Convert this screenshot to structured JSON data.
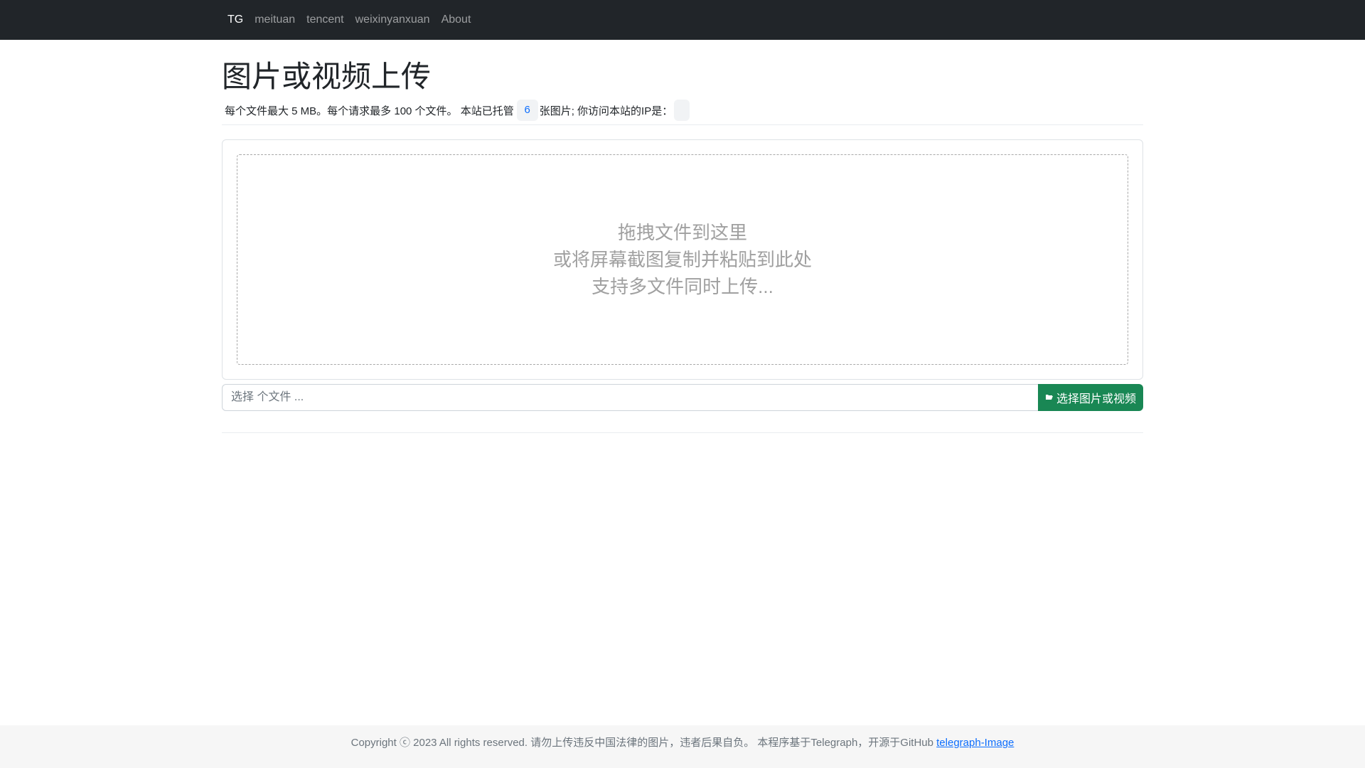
{
  "nav": {
    "items": [
      {
        "label": "TG",
        "active": true
      },
      {
        "label": "meituan",
        "active": false
      },
      {
        "label": "tencent",
        "active": false
      },
      {
        "label": "weixinyanxuan",
        "active": false
      },
      {
        "label": "About",
        "active": false
      }
    ]
  },
  "header": {
    "title": "图片或视频上传",
    "info_prefix": "每个文件最大 5 MB。每个请求最多 100 个文件。 本站已托管",
    "hosted_count": "6",
    "info_suffix": "张图片; 你访问本站的IP是：",
    "ip_value": ""
  },
  "dropzone": {
    "line1": "拖拽文件到这里",
    "line2": "或将屏幕截图复制并粘贴到此处",
    "line3": "支持多文件同时上传..."
  },
  "file_picker": {
    "placeholder": "选择 个文件 ...",
    "button_label": "选择图片或视频",
    "button_icon": "folder-open-icon"
  },
  "footer": {
    "text": "Copyright ⓒ 2023 All rights reserved. 请勿上传违反中国法律的图片，违者后果自负。 本程序基于Telegraph，开源于GitHub ",
    "link_label": "telegraph-Image"
  },
  "colors": {
    "navbar_bg": "#212529",
    "accent_green": "#198754",
    "link_blue": "#0d6efd"
  }
}
